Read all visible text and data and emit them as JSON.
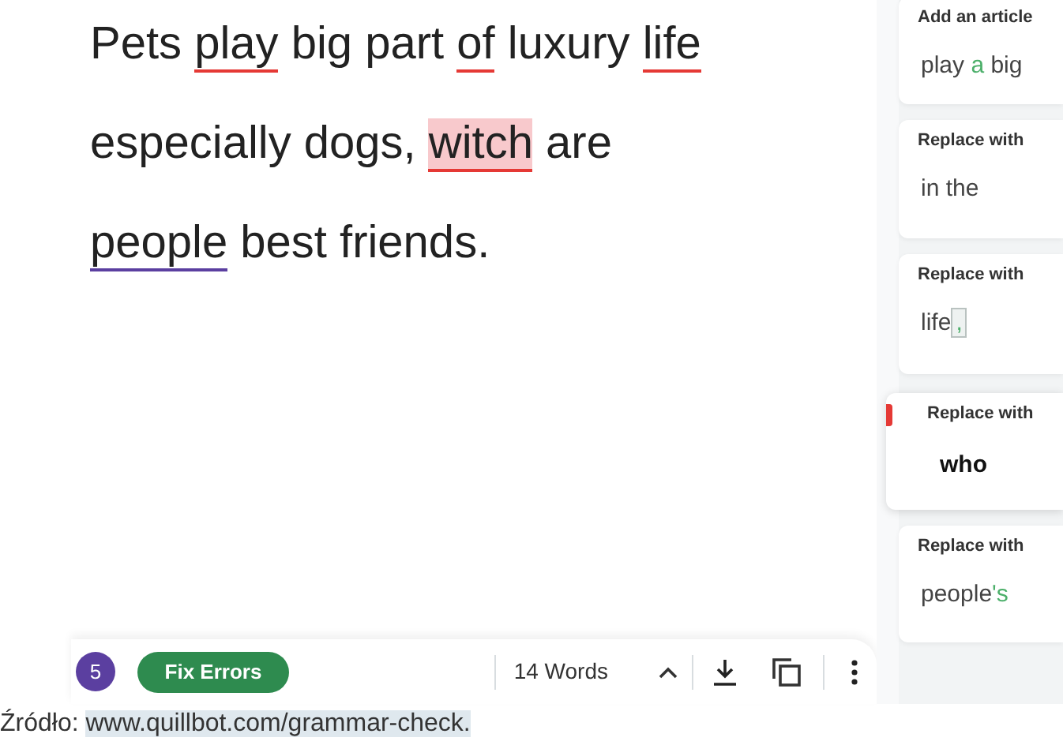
{
  "editor": {
    "lines": [
      [
        {
          "text": "Pets ",
          "kind": "plain"
        },
        {
          "text": "play",
          "kind": "error"
        },
        {
          "text": " big part ",
          "kind": "plain"
        },
        {
          "text": "of",
          "kind": "error"
        },
        {
          "text": " luxury ",
          "kind": "plain"
        },
        {
          "text": "life",
          "kind": "error"
        }
      ],
      [
        {
          "text": "especially dogs, ",
          "kind": "plain"
        },
        {
          "text": "witch",
          "kind": "active-error"
        },
        {
          "text": " are",
          "kind": "plain"
        }
      ],
      [
        {
          "text": "people",
          "kind": "style"
        },
        {
          "text": " best friends.",
          "kind": "plain"
        }
      ]
    ]
  },
  "suggestions": [
    {
      "label": "Add an article",
      "selected": false,
      "parts": [
        {
          "text": "play ",
          "kind": "plain"
        },
        {
          "text": "a",
          "kind": "added"
        },
        {
          "text": " big",
          "kind": "plain"
        }
      ]
    },
    {
      "label": "Replace with",
      "selected": false,
      "parts": [
        {
          "text": "in the",
          "kind": "plain"
        }
      ]
    },
    {
      "label": "Replace with",
      "selected": false,
      "parts": [
        {
          "text": "life",
          "kind": "plain"
        },
        {
          "text": ",",
          "kind": "added-mark"
        }
      ]
    },
    {
      "label": "Replace with",
      "selected": true,
      "parts": [
        {
          "text": "who",
          "kind": "plain"
        }
      ]
    },
    {
      "label": "Replace with",
      "selected": false,
      "parts": [
        {
          "text": "people",
          "kind": "plain"
        },
        {
          "text": "'s",
          "kind": "added"
        }
      ]
    }
  ],
  "toolbar": {
    "error_count": "5",
    "fix_button": "Fix Errors",
    "word_count": "14 Words"
  },
  "caption": {
    "prefix": "Źródło: ",
    "link": "www.quillbot.com/grammar-check."
  }
}
